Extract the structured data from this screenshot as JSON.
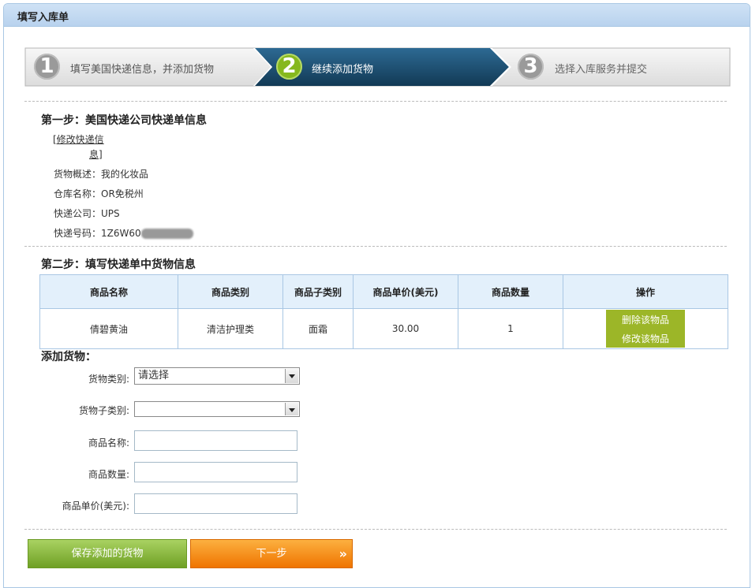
{
  "panel": {
    "title": "填写入库单"
  },
  "steps": [
    {
      "num": "1",
      "label": "填写美国快递信息，并添加货物"
    },
    {
      "num": "2",
      "label": "继续添加货物"
    },
    {
      "num": "3",
      "label": "选择入库服务并提交"
    }
  ],
  "section1": {
    "title": "第一步：美国快递公司快递单信息",
    "edit_link_line1": "[修改快递信",
    "edit_link_line2": "息]",
    "fields": [
      {
        "label": "货物概述：",
        "value": "我的化妆品"
      },
      {
        "label": "仓库名称：",
        "value": "OR免税州"
      },
      {
        "label": "快递公司：",
        "value": "UPS"
      },
      {
        "label": "快递号码：",
        "value": "1Z6W60"
      }
    ]
  },
  "section2": {
    "title": "第二步：填写快递单中货物信息",
    "columns": [
      "商品名称",
      "商品类别",
      "商品子类别",
      "商品单价(美元)",
      "商品数量",
      "操作"
    ],
    "rows": [
      {
        "name": "倩碧黄油",
        "category": "清洁护理类",
        "subcategory": "面霜",
        "price": "30.00",
        "qty": "1"
      }
    ],
    "delete_label": "删除该物品",
    "edit_label": "修改该物品"
  },
  "add_goods": {
    "title": "添加货物：",
    "category_label": "货物类别:",
    "category_value": "请选择",
    "subcategory_label": "货物子类别:",
    "subcategory_value": "",
    "name_label": "商品名称:",
    "name_value": "",
    "qty_label": "商品数量:",
    "qty_value": "",
    "price_label": "商品单价(美元):",
    "price_value": ""
  },
  "buttons": {
    "save": "保存添加的货物",
    "next": "下一步",
    "next_chevron": "»"
  },
  "colors": {
    "step_active": "#1e4a68",
    "step_inactive": "#e6e6e6",
    "green": "#9cb628",
    "orange": "#f58a0e"
  }
}
